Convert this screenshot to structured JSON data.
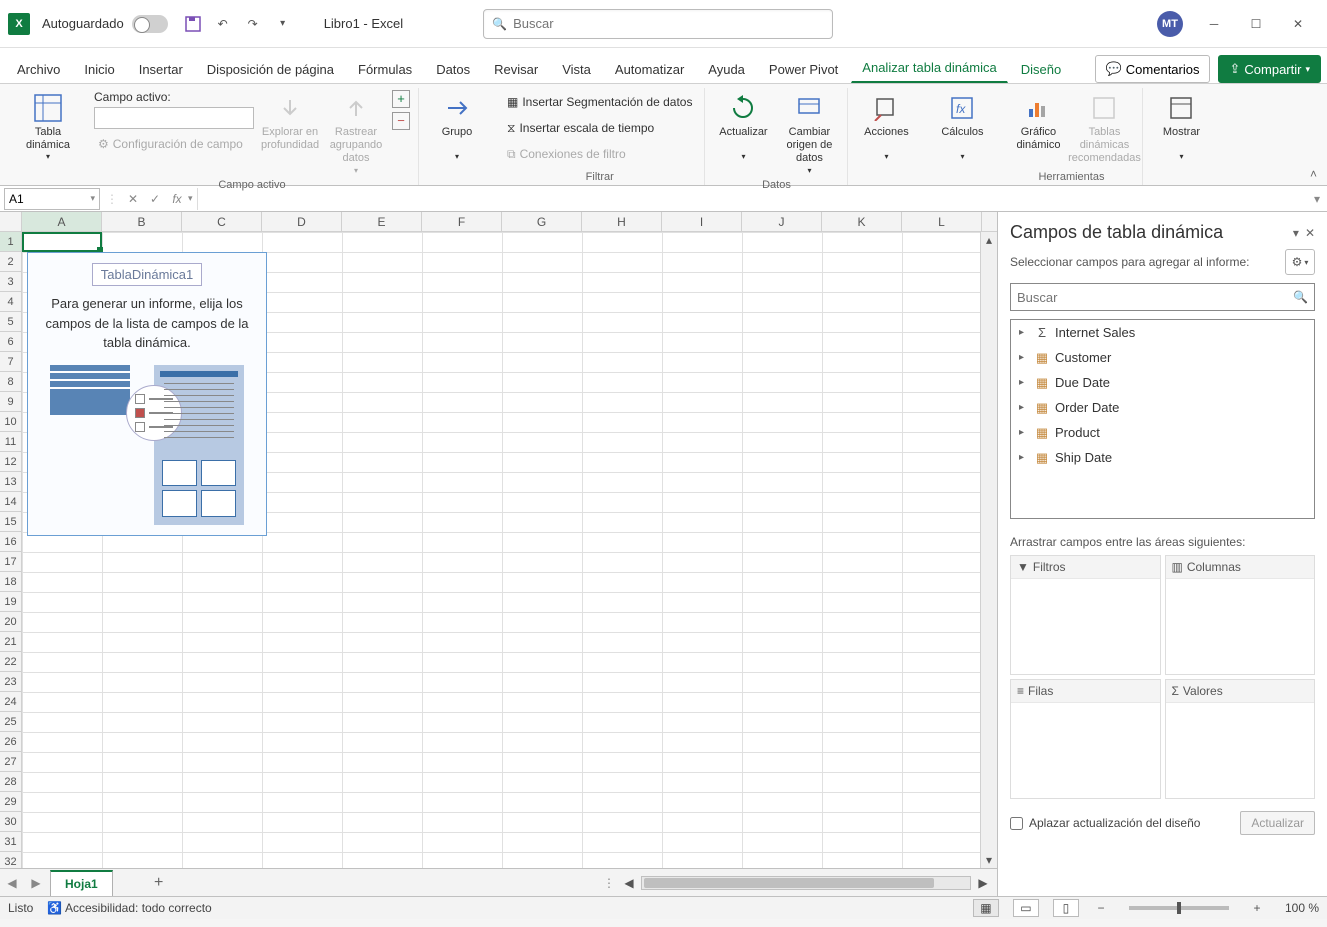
{
  "title": {
    "autosave": "Autoguardado",
    "document": "Libro1 - Excel",
    "search_placeholder": "Buscar",
    "user_initials": "MT"
  },
  "tabs": {
    "archivo": "Archivo",
    "inicio": "Inicio",
    "insertar": "Insertar",
    "disposicion": "Disposición de página",
    "formulas": "Fórmulas",
    "datos": "Datos",
    "revisar": "Revisar",
    "vista": "Vista",
    "automatizar": "Automatizar",
    "ayuda": "Ayuda",
    "powerpivot": "Power Pivot",
    "analizar": "Analizar tabla dinámica",
    "diseno": "Diseño",
    "comentarios": "Comentarios",
    "compartir": "Compartir"
  },
  "ribbon": {
    "tabla_dinamica": "Tabla dinámica",
    "campo_activo_label": "Campo activo:",
    "config_campo": "Configuración de campo",
    "explorar": "Explorar en profundidad",
    "rastrear": "Rastrear agrupando datos",
    "grupo": "Grupo",
    "ins_segment": "Insertar Segmentación de datos",
    "ins_escala": "Insertar escala de tiempo",
    "conex_filtro": "Conexiones de filtro",
    "actualizar": "Actualizar",
    "cambiar_origen": "Cambiar origen de datos",
    "acciones": "Acciones",
    "calculos": "Cálculos",
    "grafico": "Gráfico dinámico",
    "tablas_rec": "Tablas dinámicas recomendadas",
    "mostrar": "Mostrar",
    "g_campo": "Campo activo",
    "g_filtrar": "Filtrar",
    "g_datos": "Datos",
    "g_herr": "Herramientas"
  },
  "formula_bar": {
    "namebox": "A1"
  },
  "columns": [
    "A",
    "B",
    "C",
    "D",
    "E",
    "F",
    "G",
    "H",
    "I",
    "J",
    "K",
    "L"
  ],
  "rows_count": 32,
  "pt_placeholder": {
    "name": "TablaDinámica1",
    "hint": "Para generar un informe, elija los campos de la lista de campos de la tabla dinámica."
  },
  "pane": {
    "title": "Campos de tabla dinámica",
    "subtitle": "Seleccionar campos para agregar al informe:",
    "search_placeholder": "Buscar",
    "fields": [
      {
        "name": "Internet Sales",
        "type": "measure"
      },
      {
        "name": "Customer",
        "type": "table"
      },
      {
        "name": "Due Date",
        "type": "table"
      },
      {
        "name": "Order Date",
        "type": "table"
      },
      {
        "name": "Product",
        "type": "table"
      },
      {
        "name": "Ship Date",
        "type": "table"
      }
    ],
    "drag_hint": "Arrastrar campos entre las áreas siguientes:",
    "area_filtros": "Filtros",
    "area_columnas": "Columnas",
    "area_filas": "Filas",
    "area_valores": "Valores",
    "defer": "Aplazar actualización del diseño",
    "update": "Actualizar"
  },
  "sheet": {
    "name": "Hoja1"
  },
  "status": {
    "ready": "Listo",
    "accessibility": "Accesibilidad: todo correcto",
    "zoom": "100 %"
  }
}
